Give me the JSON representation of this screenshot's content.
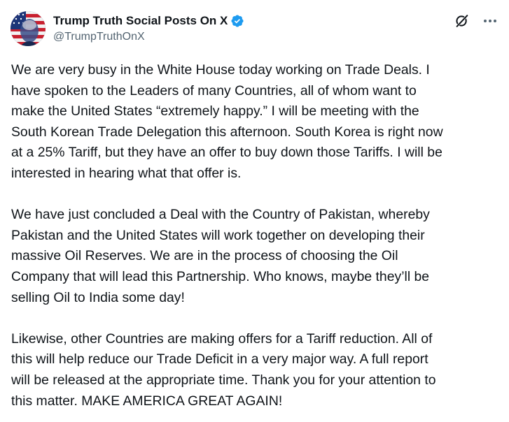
{
  "post": {
    "author": {
      "display_name": "Trump Truth Social Posts On X",
      "handle": "@TrumpTruthOnX",
      "verified": true,
      "verified_badge_color": "#1d9bf0",
      "avatar": "flag-portrait-avatar"
    },
    "header_icons": [
      "grok-icon",
      "more-options-icon"
    ],
    "paragraphs": [
      "We are very busy in the White House today working on Trade Deals. I\nhave spoken to the Leaders of many Countries, all of whom want to\nmake the United States “extremely happy.” I will be meeting with the\nSouth Korean Trade Delegation this afternoon. South Korea is right now\nat a 25% Tariff, but they have an offer to buy down those Tariffs. I will be\ninterested in hearing what that offer is.",
      "We have just concluded a Deal with the Country of Pakistan, whereby\nPakistan and the United States will work together on developing their\nmassive Oil Reserves. We are in the process of choosing the Oil\nCompany that will lead this Partnership. Who knows, maybe they’ll be\nselling Oil to India some day!",
      "Likewise, other Countries are making offers for a Tariff reduction. All of\nthis will help reduce our Trade Deficit in a very major way. A full report\nwill be released at the appropriate time. Thank you for your attention to\nthis matter. MAKE AMERICA GREAT AGAIN!"
    ]
  }
}
